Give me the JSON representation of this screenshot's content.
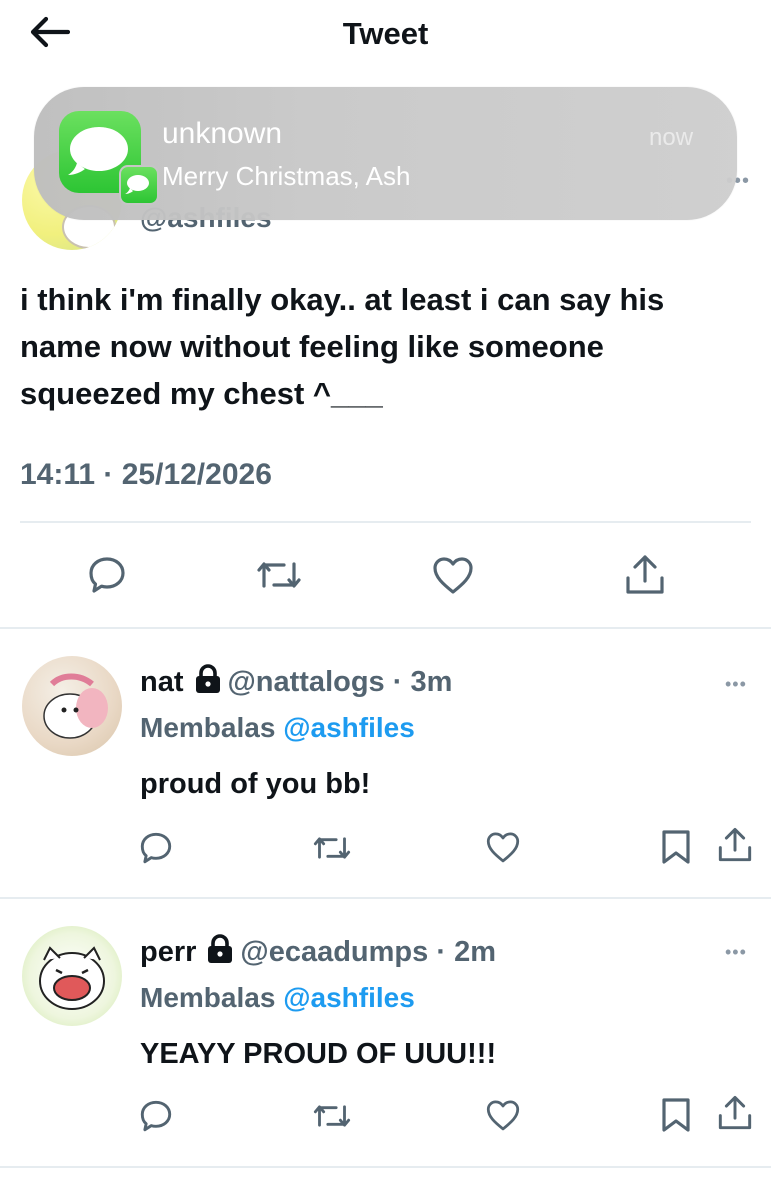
{
  "header": {
    "title": "Tweet",
    "back_icon": "arrow-left-icon"
  },
  "notification": {
    "app_icon": "messages-icon",
    "title": "unknown",
    "body": "Merry Christmas, Ash",
    "time": "now"
  },
  "main_tweet": {
    "handle": "@ashfiles",
    "more": "•••",
    "text": "i think i'm finally okay.. at least i can say his name now without feeling like someone squeezed my chest ^___",
    "timestamp": "14:11 · 25/12/2026",
    "actions": [
      "reply-icon",
      "retweet-icon",
      "like-icon",
      "share-icon"
    ]
  },
  "replies": [
    {
      "name": "nat",
      "handle": "@nattalogs",
      "dot": "·",
      "time": "3m",
      "replying_label": "Membalas",
      "replying_to": "@ashfiles",
      "text": "proud of you bb!",
      "more": "•••"
    },
    {
      "name": "perr",
      "handle": "@ecaadumps",
      "dot": "·",
      "time": "2m",
      "replying_label": "Membalas",
      "replying_to": "@ashfiles",
      "text": "YEAYY PROUD OF UUU!!!",
      "more": "•••"
    }
  ],
  "colors": {
    "text": "#0f1419",
    "secondary": "#536471",
    "link": "#1d9bf0",
    "divider": "#e6ecf0",
    "imessage_green": "#34c759"
  }
}
